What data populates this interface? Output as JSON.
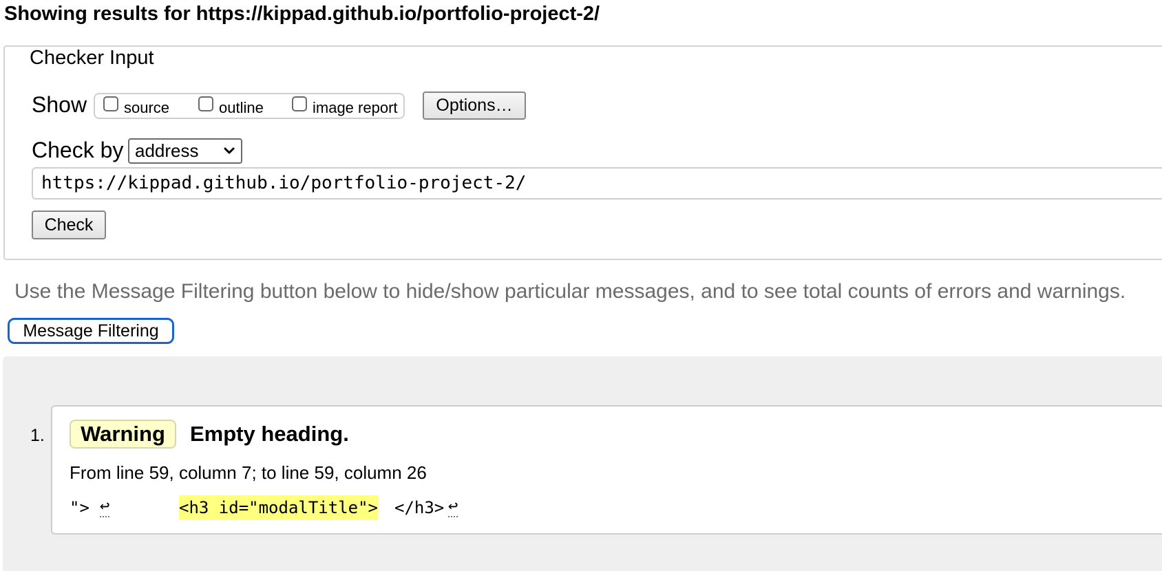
{
  "results": {
    "heading": "Showing results for https://kippad.github.io/portfolio-project-2/"
  },
  "checker": {
    "legend": "Checker Input",
    "show_label": "Show",
    "options": [
      {
        "label": "source",
        "checked": false
      },
      {
        "label": "outline",
        "checked": false
      },
      {
        "label": "image report",
        "checked": false
      }
    ],
    "options_button": "Options…",
    "check_by_label": "Check by",
    "check_by_value": "address",
    "url_value": "https://kippad.github.io/portfolio-project-2/",
    "check_button": "Check"
  },
  "filtering": {
    "info": "Use the Message Filtering button below to hide/show particular messages, and to see total counts of errors and warnings.",
    "button": "Message Filtering",
    "button_border_color": "#1b64d0"
  },
  "messages": [
    {
      "index": "1.",
      "type": "Warning",
      "title": "Empty heading.",
      "location": "From line 59, column 7; to line 59, column 26",
      "extract": {
        "before": "\">",
        "highlight": "<h3 id=\"modalTitle\">",
        "after": "</h3>"
      },
      "badge_color": "#ffffcc",
      "highlight_color": "#ffff80"
    }
  ],
  "icons": {
    "carriage_return": "↩",
    "select_arrow": "chevron-down-icon"
  }
}
